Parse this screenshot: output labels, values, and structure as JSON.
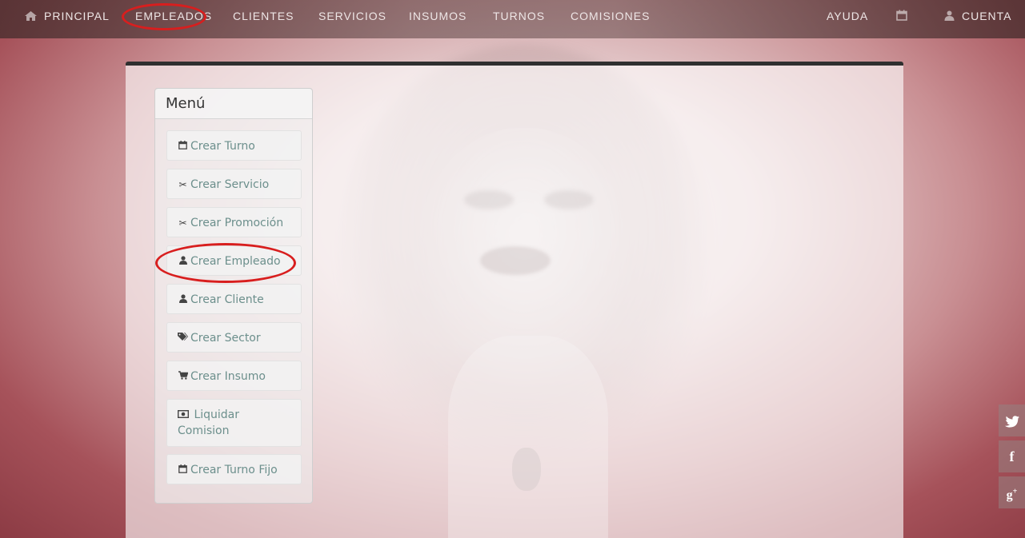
{
  "nav": {
    "principal": "PRINCIPAL",
    "empleados": "EMPLEADOS",
    "clientes": "CLIENTES",
    "servicios": "SERVICIOS",
    "insumos": "INSUMOS",
    "turnos": "TURNOS",
    "comisiones": "COMISIONES",
    "ayuda": "AYUDA",
    "cuenta": "CUENTA"
  },
  "menu": {
    "title": "Menú",
    "items": [
      {
        "label": "Crear Turno",
        "icon": "calendar-icon"
      },
      {
        "label": "Crear Servicio",
        "icon": "scissors-icon"
      },
      {
        "label": "Crear Promoción",
        "icon": "scissors-icon"
      },
      {
        "label": "Crear Empleado",
        "icon": "user-icon"
      },
      {
        "label": "Crear Cliente",
        "icon": "user-icon"
      },
      {
        "label": "Crear Sector",
        "icon": "tags-icon"
      },
      {
        "label": "Crear Insumo",
        "icon": "cart-icon"
      },
      {
        "label_line1": "Liquidar",
        "label_line2": "Comision",
        "icon": "money-icon"
      },
      {
        "label": "Crear Turno Fijo",
        "icon": "calendar-icon"
      }
    ]
  },
  "social": {
    "twitter": "twitter-icon",
    "facebook": "facebook-icon",
    "googleplus": "google-plus-icon"
  },
  "colors": {
    "annotation_ring": "#d81e1e",
    "menu_text": "#6c8f8c",
    "panel_top_border": "#2f2f2f"
  }
}
